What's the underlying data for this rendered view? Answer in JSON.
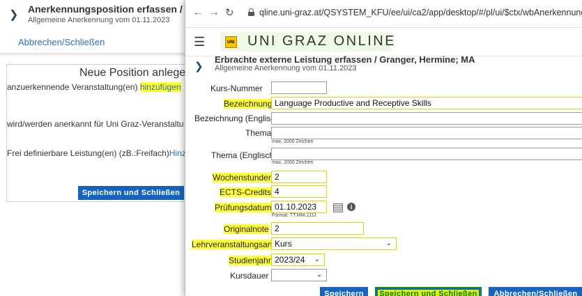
{
  "background_window": {
    "title": "Anerkennungsposition erfassen  / Gr",
    "subtitle": "Allgemeine Anerkennung vom 01.11.2023",
    "cancel_link": "Abbrechen/Schließen",
    "panel_heading": "Neue Position anlegen",
    "line1_prefix": "anzuerkennende Veranstaltung(en) ",
    "line1_link": "hinzufügen",
    "line2": "wird/werden anerkannt für Uni Graz-Veranstaltu",
    "line3_prefix": "Frei definierbare Leistung(en) (zB.:Freifach)",
    "line3_link": "Hinzu",
    "save_close_button": "Speichern und Schließen"
  },
  "browser": {
    "url": "qline.uni-graz.at/QSYSTEM_KFU/ee/ui/ca2/app/desktop/#/pl/ui/$ctx/wbAnerkennungen.kur"
  },
  "app": {
    "brand": "UNI GRAZ ONLINE",
    "logo_text": "UNI",
    "page_title": "Erbrachte externe Leistung erfassen  / Granger, Hermine; MA",
    "page_subtitle": "Allgemeine Anerkennung vom 01.11.2023"
  },
  "form": {
    "kurs_nummer_label": "Kurs-Nummer",
    "kurs_nummer_value": "",
    "bezeichnung_label": "Bezeichnung",
    "bezeichnung_value": "Language Productive and Receptive Skills",
    "bezeichnung_en_label": "Bezeichnung (English)",
    "bezeichnung_en_value": "",
    "thema_label": "Thema",
    "thema_hint": "max. 2000 Zeichen",
    "thema_en_label": "Thema (Englisch)",
    "thema_en_hint": "max. 2000 Zeichen",
    "wochenstunden_label": "Wochenstunden",
    "wochenstunden_value": "2",
    "ects_label": "ECTS-Credits",
    "ects_value": "4",
    "pruefungsdatum_label": "Prüfungsdatum",
    "pruefungsdatum_value": "01.10.2023",
    "pruefungsdatum_hint": "Format: TT.MM.JJJJ",
    "originalnote_label": "Originalnote",
    "originalnote_value": "2",
    "lv_art_label": "Lehrveranstaltungsart",
    "lv_art_value": "Kurs",
    "studienjahr_label": "Studienjahr",
    "studienjahr_value": "2023/24",
    "kursdauer_label": "Kursdauer",
    "kursdauer_value": ""
  },
  "buttons": {
    "save": "Speichern",
    "save_close": "Speichern und Schließen",
    "cancel_close": "Abbrechen/Schließen"
  },
  "icons": {
    "home": "home-icon",
    "calendar": "calendar-icon",
    "info": "info-icon",
    "menu": "hamburger-menu-icon"
  },
  "colors": {
    "primary_button": "#1565c0",
    "highlight": "#ffff3a",
    "link": "#2a6ebb"
  }
}
